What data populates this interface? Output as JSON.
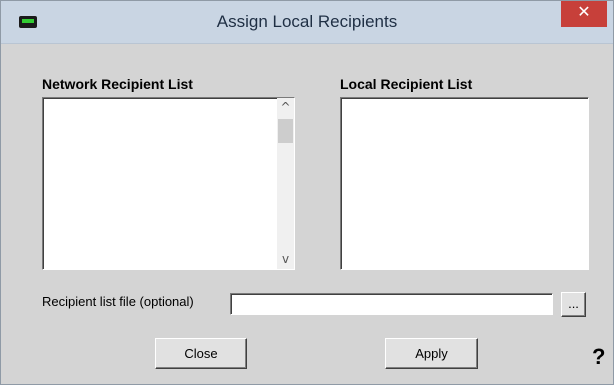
{
  "window": {
    "title": "Assign Local Recipients",
    "close_glyph": "✕"
  },
  "network": {
    "label": "Network Recipient List",
    "items": [],
    "scroll_up": "^",
    "scroll_down": "v"
  },
  "local": {
    "label": "Local Recipient List",
    "items": []
  },
  "file": {
    "label": "Recipient list file (optional)",
    "value": "",
    "browse_label": "..."
  },
  "buttons": {
    "close": "Close",
    "apply": "Apply",
    "help": "?"
  },
  "icons": {
    "app": "terminal-icon",
    "help": "help-icon"
  },
  "colors": {
    "titlebar": "#c9d5e3",
    "close_button": "#c7403a",
    "dialog_bg": "#d4d4d4",
    "app_icon_accent": "#33cc33"
  }
}
